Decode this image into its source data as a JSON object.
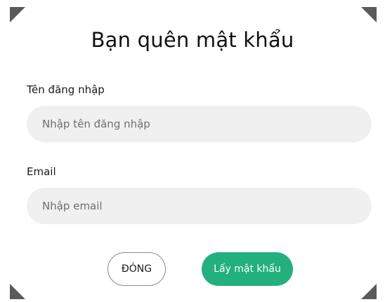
{
  "dialog": {
    "title": "Bạn quên mật khẩu",
    "username": {
      "label": "Tên đăng nhập",
      "placeholder": "Nhập tên đăng nhập",
      "value": ""
    },
    "email": {
      "label": "Email",
      "placeholder": "Nhập email",
      "value": ""
    },
    "buttons": {
      "close_label": "ĐÓNG",
      "submit_label": "Lấy mật khẩu"
    }
  },
  "colors": {
    "accent": "#22b07d",
    "input_background": "#f0f0f0",
    "frame_corner": "#5a5a5a"
  }
}
